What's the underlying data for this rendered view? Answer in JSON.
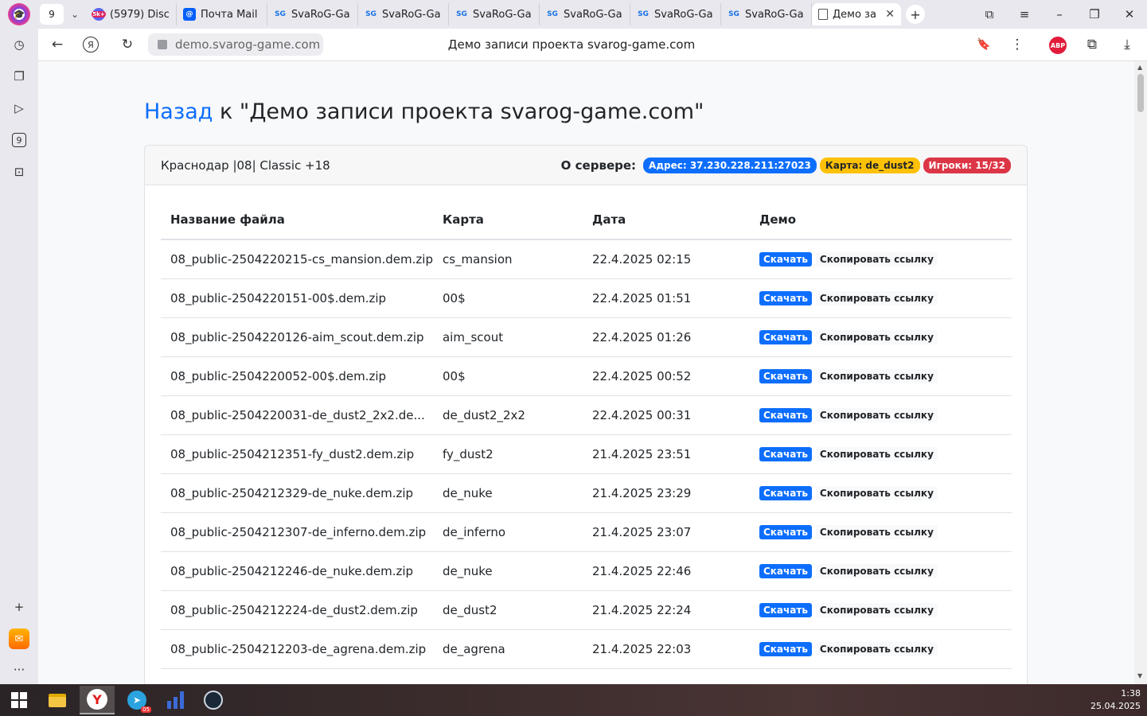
{
  "browser": {
    "tab_count": "9",
    "tabs": [
      {
        "title": "(5979) Disc",
        "icon": "discord-icon",
        "badge": "5k+"
      },
      {
        "title": "Почта Mail",
        "icon": "mail-icon"
      },
      {
        "title": "SvaRoG-Ga",
        "icon": "svarog-icon"
      },
      {
        "title": "SvaRoG-Ga",
        "icon": "svarog-icon"
      },
      {
        "title": "SvaRoG-Ga",
        "icon": "svarog-icon"
      },
      {
        "title": "SvaRoG-Ga",
        "icon": "svarog-icon"
      },
      {
        "title": "SvaRoG-Ga",
        "icon": "svarog-icon"
      },
      {
        "title": "SvaRoG-Ga",
        "icon": "svarog-icon"
      }
    ],
    "active_tab": {
      "title": "Демо за",
      "icon": "page-icon"
    },
    "url": "demo.svarog-game.com",
    "page_title": "Демо записи проекта svarog-game.com",
    "abp_label": "ABP",
    "sidebar_counter": "9"
  },
  "page": {
    "back_link": "Назад",
    "heading_rest": " к \"Демо записи проекта svarog-game.com\"",
    "server_name": "Краснодар |08| Classic +18",
    "server_label": "О сервере",
    "badges": {
      "address": "Адрес: 37.230.228.211:27023",
      "map": "Карта: de_dust2",
      "players": "Игроки: 15/32"
    },
    "columns": [
      "Название файла",
      "Карта",
      "Дата",
      "Демо"
    ],
    "download_label": "Скачать",
    "copy_label": "Скопировать ссылку",
    "rows": [
      {
        "file": "08_public-2504220215-cs_mansion.dem.zip",
        "map": "cs_mansion",
        "date": "22.4.2025 02:15"
      },
      {
        "file": "08_public-2504220151-00$.dem.zip",
        "map": "00$",
        "date": "22.4.2025 01:51"
      },
      {
        "file": "08_public-2504220126-aim_scout.dem.zip",
        "map": "aim_scout",
        "date": "22.4.2025 01:26"
      },
      {
        "file": "08_public-2504220052-00$.dem.zip",
        "map": "00$",
        "date": "22.4.2025 00:52"
      },
      {
        "file": "08_public-2504220031-de_dust2_2x2.de...",
        "map": "de_dust2_2x2",
        "date": "22.4.2025 00:31"
      },
      {
        "file": "08_public-2504212351-fy_dust2.dem.zip",
        "map": "fy_dust2",
        "date": "21.4.2025 23:51"
      },
      {
        "file": "08_public-2504212329-de_nuke.dem.zip",
        "map": "de_nuke",
        "date": "21.4.2025 23:29"
      },
      {
        "file": "08_public-2504212307-de_inferno.dem.zip",
        "map": "de_inferno",
        "date": "21.4.2025 23:07"
      },
      {
        "file": "08_public-2504212246-de_nuke.dem.zip",
        "map": "de_nuke",
        "date": "21.4.2025 22:46"
      },
      {
        "file": "08_public-2504212224-de_dust2.dem.zip",
        "map": "de_dust2",
        "date": "21.4.2025 22:24"
      },
      {
        "file": "08_public-2504212203-de_agrena.dem.zip",
        "map": "de_agrena",
        "date": "21.4.2025 22:03"
      }
    ]
  },
  "taskbar": {
    "time": "1:38",
    "date": "25.04.2025",
    "telegram_badge": "05"
  },
  "colors": {
    "primary": "#0d6efd",
    "warning": "#ffc107",
    "danger": "#dc3545"
  }
}
